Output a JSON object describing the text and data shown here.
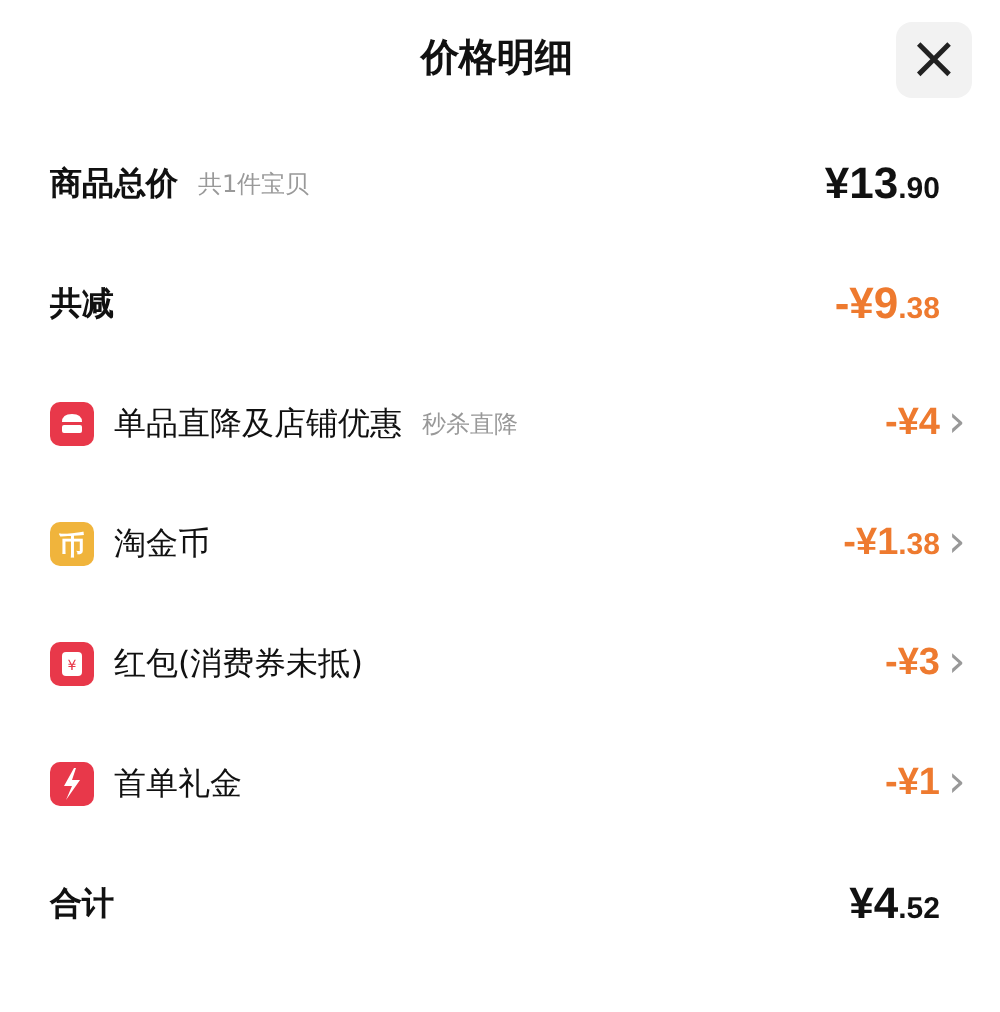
{
  "header": {
    "title": "价格明细",
    "close": "×"
  },
  "rows": [
    {
      "kind": "total",
      "label": "商品总价",
      "note": "共1件宝贝",
      "price": "¥13.90"
    },
    {
      "kind": "discount",
      "label": "共减",
      "price": "-¥9.38"
    },
    {
      "kind": "item",
      "color": "#e8384a",
      "label": "单品直降及店铺优惠",
      "note": "秒杀直降",
      "price": "-¥4",
      "chevron": "›"
    },
    {
      "kind": "item",
      "icon_text": "币",
      "color": "#f0b43c",
      "label": "淘金币",
      "price": "-¥1.38",
      "chevron": "›"
    },
    {
      "kind": "item",
      "icon_text": "¥",
      "color": "#e8384a",
      "label": "红包(消费券未抵)",
      "price": "-¥3",
      "chevron": "›"
    },
    {
      "kind": "item",
      "color": "#e8384a",
      "label": "首单礼金",
      "price": "-¥1",
      "chevron": "›"
    },
    {
      "kind": "total",
      "label": "合计",
      "price": "¥4.52"
    }
  ]
}
